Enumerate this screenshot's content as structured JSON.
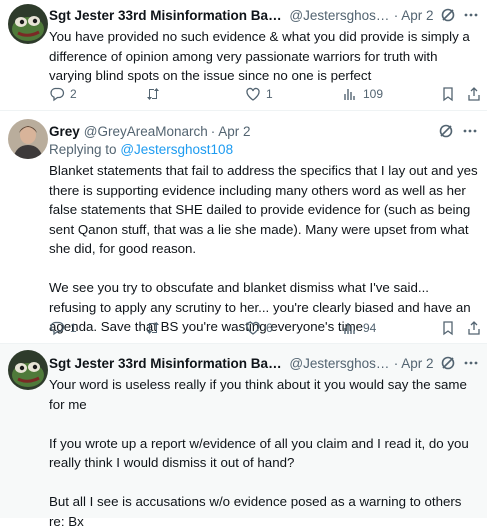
{
  "tweets": [
    {
      "display_name": "Sgt Jester 33rd Misinformation Battali...",
      "handle": "@Jestersghost1...",
      "separator": "·",
      "date": "Apr 2",
      "text": "You have provided no such evidence & what you did provide is simply a difference of opinion among very passionate warriors for truth with varying blind spots on the issue since no one is perfect",
      "replies": "2",
      "reposts": "",
      "likes": "1",
      "views": "109",
      "avatar": "frog-avatar"
    },
    {
      "display_name": "Grey",
      "handle": "@GreyAreaMonarch",
      "separator": "·",
      "date": "Apr 2",
      "replying_prefix": "Replying to",
      "replying_handle": "@Jestersghost108",
      "text": "Blanket statements that fail to address the specifics that I lay out and yes there is supporting evidence including many others word as well as her false statements that SHE dailed to provide evidence for (such as being sent Qanon stuff, that was a lie she made). Many were upset from what she did, for good reason.\n\nWe see you try to obscufate and blanket dismiss what I've said... refusing to apply any scrutiny to her... you're clearly biased and have an agenda. Save that BS you're wasting everyone's time",
      "replies": "1",
      "reposts": "",
      "likes": "6",
      "views": "94",
      "avatar": "person-avatar"
    },
    {
      "display_name": "Sgt Jester 33rd Misinformation Battali...",
      "handle": "@Jestersghost1...",
      "separator": "·",
      "date": "Apr 2",
      "text": "Your word is useless really if you think about it you would say the same for me\n\nIf you wrote up a report w/evidence of all you claim and I read it, do you really think I would dismiss it out of hand?\n\nBut all I see is accusations w/o evidence posed as a warning to others re: Bx",
      "avatar": "frog-avatar"
    }
  ],
  "colors": {
    "text": "#0f1419",
    "secondary": "#536471",
    "link": "#1d9bf0",
    "highlight_bg": "#f7f9f9"
  }
}
